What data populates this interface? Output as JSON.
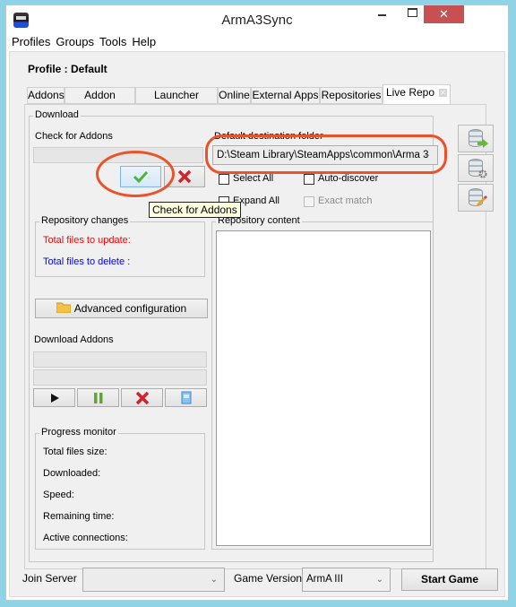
{
  "window": {
    "title": "ArmA3Sync",
    "close_glyph": "✕"
  },
  "menu": [
    "Profiles",
    "Groups",
    "Tools",
    "Help"
  ],
  "profile_label": "Profile : Default",
  "tabs": [
    {
      "label": "Addons",
      "active": false
    },
    {
      "label": "Addon Options",
      "active": false
    },
    {
      "label": "Launcher Options",
      "active": false
    },
    {
      "label": "Online",
      "active": false
    },
    {
      "label": "External Apps",
      "active": false
    },
    {
      "label": "Repositories",
      "active": false
    },
    {
      "label": "Live Repo",
      "active": true,
      "closable": true
    }
  ],
  "download": {
    "group_label": "Download",
    "check_label": "Check for Addons",
    "check_button_icon": "checkmark-icon",
    "cancel_button_icon": "red-x-icon",
    "tooltip": "Check for Addons",
    "dest_label": "Default destination folder",
    "dest_value": "D:\\Steam Library\\SteamApps\\common\\Arma 3",
    "select_all": "Select All",
    "auto_discover": "Auto-discover",
    "expand_all": "Expand All",
    "exact_match": "Exact match"
  },
  "repo_changes": {
    "label": "Repository changes",
    "update": "Total files to update:",
    "delete": "Total files to delete :",
    "update_color": "#ff0000",
    "delete_color": "#0000ff"
  },
  "repo_content": {
    "label": "Repository content"
  },
  "advanced": {
    "label": "Advanced configuration"
  },
  "download_addons": {
    "label": "Download Addons"
  },
  "progress": {
    "label": "Progress monitor",
    "items": [
      "Total files size:",
      "Downloaded:",
      "Speed:",
      "Remaining time:",
      "Active connections:"
    ]
  },
  "footer": {
    "join_server": "Join Server",
    "join_value": "",
    "game_version": "Game Version",
    "game_value": "ArmA III",
    "start": "Start Game"
  },
  "annotation_color": "#e8532a"
}
